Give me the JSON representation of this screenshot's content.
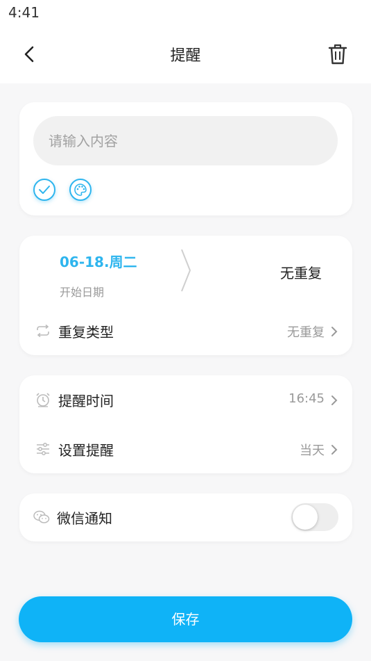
{
  "status_bar": {
    "time": "4:41"
  },
  "header": {
    "title": "提醒",
    "back_icon": "back-arrow-icon",
    "trash_icon": "trash-icon"
  },
  "content_card": {
    "input_placeholder": "请输入内容",
    "input_value": "",
    "check_icon": "check-circle-icon",
    "palette_icon": "palette-icon",
    "accent_color": "#2eb5ee"
  },
  "date_card": {
    "date_value": "06-18.周二",
    "date_label": "开始日期",
    "repeat_value": "无重复",
    "repeat_type_label": "重复类型",
    "repeat_type_value": "无重复",
    "repeat_icon": "repeat-icon"
  },
  "reminder_card": {
    "time_label": "提醒时间",
    "time_value": "16:45",
    "time_icon": "alarm-clock-icon",
    "setting_label": "设置提醒",
    "setting_value": "当天",
    "setting_icon": "sliders-icon"
  },
  "wechat_card": {
    "label": "微信通知",
    "icon": "wechat-icon",
    "enabled": false
  },
  "save_button": {
    "label": "保存",
    "color": "#0fb3f7"
  }
}
